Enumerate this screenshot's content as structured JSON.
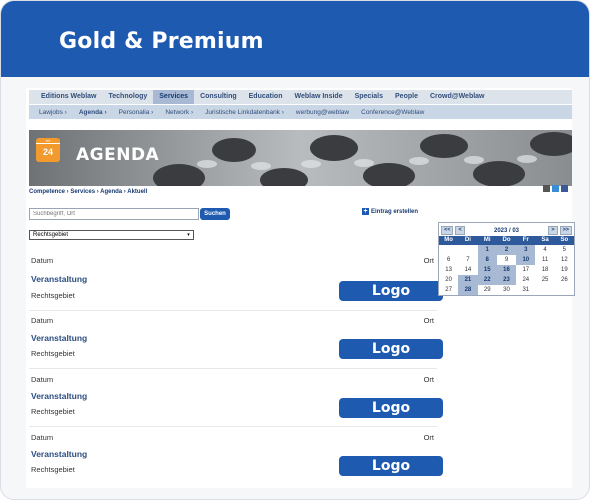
{
  "banner": {
    "title": "Gold & Premium"
  },
  "nav_main": [
    "Editions Weblaw",
    "Technology",
    "Services",
    "Consulting",
    "Education",
    "Weblaw Inside",
    "Specials",
    "People",
    "Crowd@Weblaw"
  ],
  "nav_active_index": 2,
  "nav_sub": [
    "Lawjobs ›",
    "Agenda ›",
    "Personalia ›",
    "Network ›",
    "Juristische Linkdatenbank ›",
    "werbung@weblaw",
    "Conference@Weblaw"
  ],
  "hero": {
    "icon_text": "24",
    "title": "AGENDA"
  },
  "breadcrumb": "Competence › Services › Agenda › Aktuell",
  "search": {
    "placeholder": "Suchbegriff, Ort",
    "button": "Suchen"
  },
  "filter": {
    "selected": "Rechtsgebiet"
  },
  "create_link": "Eintrag erstellen",
  "events": [
    {
      "datum": "Datum",
      "ort": "Ort",
      "title": "Veranstaltung",
      "sub": "Rechtsgebiet",
      "logo": "Logo"
    },
    {
      "datum": "Datum",
      "ort": "Ort",
      "title": "Veranstaltung",
      "sub": "Rechtsgebiet",
      "logo": "Logo"
    },
    {
      "datum": "Datum",
      "ort": "Ort",
      "title": "Veranstaltung",
      "sub": "Rechtsgebiet",
      "logo": "Logo"
    },
    {
      "datum": "Datum",
      "ort": "Ort",
      "title": "Veranstaltung",
      "sub": "Rechtsgebiet",
      "logo": "Logo"
    }
  ],
  "calendar": {
    "prev_year": "<<",
    "prev_month": "<",
    "month": "2023 / 03",
    "next_month": ">",
    "next_year": ">>",
    "dow": [
      "Mo",
      "Di",
      "Mi",
      "Do",
      "Fr",
      "Sa",
      "So"
    ],
    "weeks": [
      [
        "",
        "",
        "1",
        "2",
        "3",
        "4",
        "5"
      ],
      [
        "6",
        "7",
        "8",
        "9",
        "10",
        "11",
        "12"
      ],
      [
        "13",
        "14",
        "15",
        "16",
        "17",
        "18",
        "19"
      ],
      [
        "20",
        "21",
        "22",
        "23",
        "24",
        "25",
        "26"
      ],
      [
        "27",
        "28",
        "29",
        "30",
        "31",
        "",
        ""
      ]
    ],
    "highlighted": [
      "1",
      "2",
      "3",
      "8",
      "10",
      "15",
      "16",
      "21",
      "22",
      "23",
      "28"
    ]
  },
  "colors": {
    "brand": "#1f5ab1",
    "nav": "#dde3ea",
    "accent": "#f39a2e"
  }
}
